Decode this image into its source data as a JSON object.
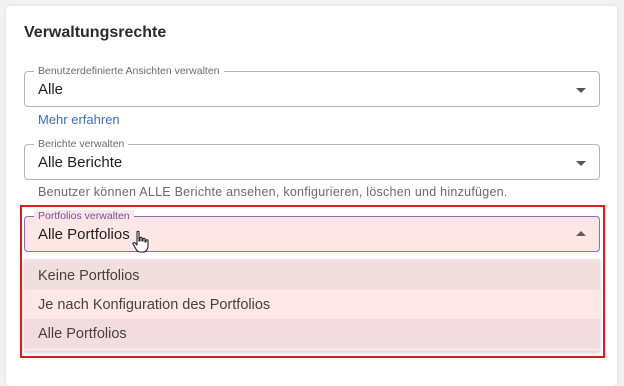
{
  "section": {
    "title": "Verwaltungsrechte"
  },
  "views_field": {
    "label": "Benutzerdefinierte Ansichten verwalten",
    "value": "Alle"
  },
  "learn_more": {
    "label": "Mehr erfahren"
  },
  "reports_field": {
    "label": "Berichte verwalten",
    "value": "Alle Berichte",
    "helper": "Benutzer können ALLE Berichte ansehen, konfigurieren, löschen und hinzufügen."
  },
  "portfolios_field": {
    "label": "Portfolios verwalten",
    "value": "Alle Portfolios"
  },
  "dropdown": {
    "options": [
      {
        "label": "Keine Portfolios"
      },
      {
        "label": "Je nach Konfiguration des Portfolios"
      },
      {
        "label": "Alle Portfolios"
      }
    ]
  },
  "colors": {
    "highlight": "#e11b1b",
    "focus_border": "#8c6bbf",
    "link": "#3e6fb0",
    "dropdown_bg": "#f9e4e4"
  },
  "icons": [
    "chevron-down-icon",
    "chevron-up-icon",
    "hand-cursor-icon"
  ]
}
